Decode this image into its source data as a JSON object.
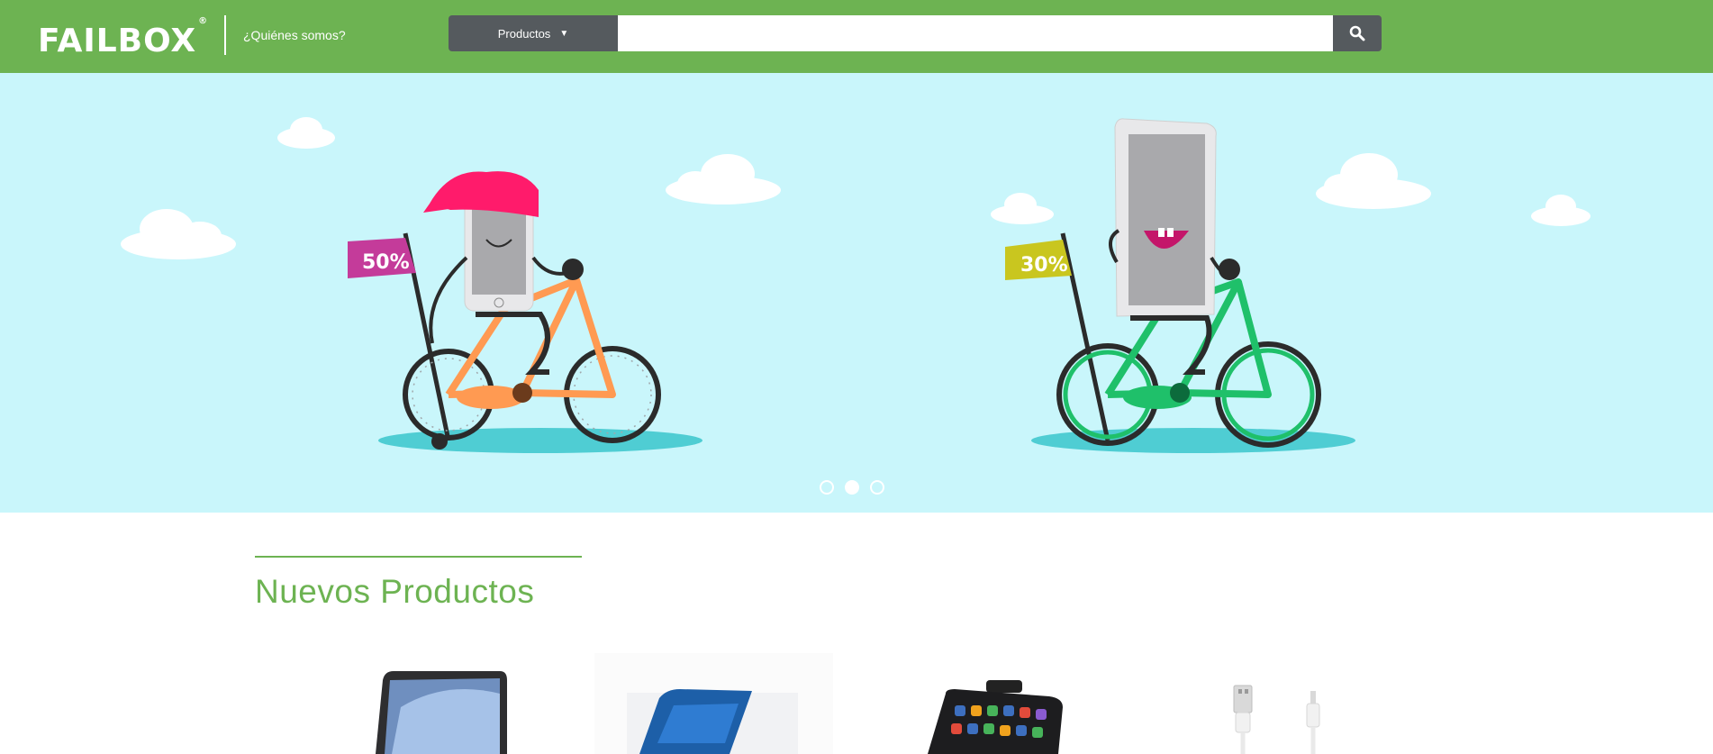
{
  "header": {
    "logo_text": "FAILBOX",
    "logo_mark": "®",
    "about_label": "¿Quiénes somos?",
    "products_label": "Productos",
    "products_caret": "▼",
    "search_placeholder": "",
    "search_value": ""
  },
  "hero": {
    "slides": [
      {
        "badge": "50%",
        "badge_color": "#c43b9a",
        "bike_color": "#ff9a52"
      },
      {
        "badge": "30%",
        "badge_color": "#c9c61f",
        "bike_color": "#1fc06a"
      }
    ],
    "carousel_dots": 3,
    "active_dot": 2
  },
  "section": {
    "title": "Nuevos Productos"
  },
  "products": [
    {
      "icon": "laptop-icon"
    },
    {
      "icon": "tablet-icon"
    },
    {
      "icon": "phone-holder-icon"
    },
    {
      "icon": "usb-cable-icon"
    }
  ],
  "colors": {
    "brand_green": "#6db352",
    "dark_gray": "#555a5e",
    "sky": "#c9f6fb"
  }
}
